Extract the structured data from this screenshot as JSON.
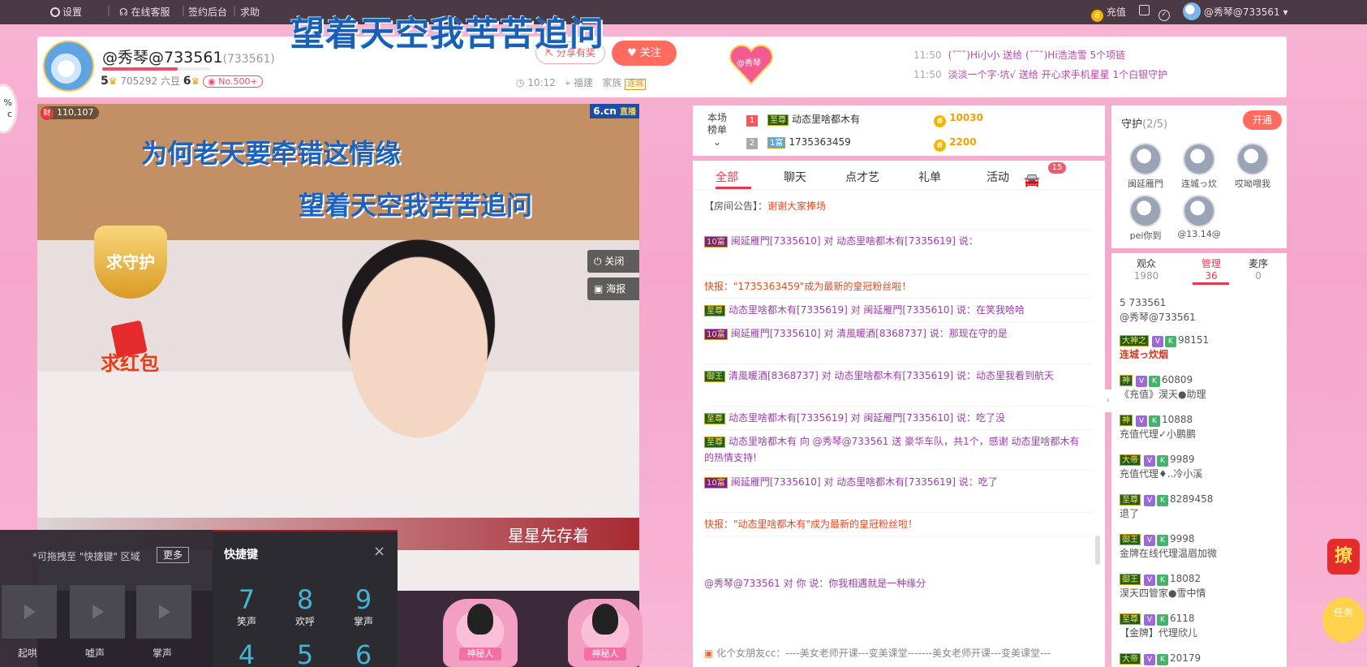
{
  "topbar": {
    "settings": "设置",
    "service": "在线客服",
    "sign_backend": "签约后台",
    "help": "求助",
    "recharge": "充值",
    "user": "@秀琴@733561"
  },
  "song": {
    "title": "望着天空我苦苦追问"
  },
  "anchor": {
    "name": "@秀琴@733561",
    "room_id": "(733561)",
    "wealth_level": "5",
    "beans": "705292 六豆",
    "star_level": "6",
    "rank_badge": "No.500+",
    "share": "分享有奖",
    "follow": "关注",
    "time": "10:12",
    "location": "福建",
    "family_label": "家族",
    "family_tag": "连城",
    "heart_badge": "@秀琴"
  },
  "gift_news": [
    {
      "time": "11:50",
      "text": "(ˇ‾ˇ)Hi小小 送给 (ˇ‾ˇ)Hi浩浩雪 5个项链"
    },
    {
      "time": "11:50",
      "text": "淡淡一个字·坑√ 送给 开心求手机星星 1个白银守护"
    }
  ],
  "video": {
    "watermark": "6.cn",
    "watermark_live": "直播",
    "coin_icon": "财",
    "coins": "110,107",
    "lyric1": "为何老天要牵错这情缘",
    "lyric2": "望着天空我苦苦追问",
    "close": "关闭",
    "poster": "海报",
    "guard": "求守护",
    "redpack": "求红包",
    "next_song": "星星先存着",
    "seat1": "神秘人",
    "seat2": "神秘人"
  },
  "drag_tip": {
    "text": "*可拖拽至 \"快捷键\" 区域",
    "more": "更多",
    "slots": [
      "起哄",
      "嘘声",
      "掌声"
    ]
  },
  "shortcut": {
    "title": "快捷键",
    "close": "×",
    "keys": [
      {
        "num": "7",
        "label": "笑声"
      },
      {
        "num": "8",
        "label": "欢呼"
      },
      {
        "num": "9",
        "label": "掌声"
      },
      {
        "num": "4",
        "label": ""
      },
      {
        "num": "5",
        "label": ""
      },
      {
        "num": "6",
        "label": ""
      }
    ]
  },
  "rank": {
    "title1": "本场",
    "title2": "榜单",
    "rows": [
      {
        "rank": "1",
        "tag": "至尊",
        "name": "动态里啥都木有",
        "score": "10030"
      },
      {
        "rank": "2",
        "tag": "1富",
        "name": "1735363459",
        "score": "2200"
      }
    ]
  },
  "chat": {
    "tabs": [
      "全部",
      "聊天",
      "点才艺",
      "礼单",
      "活动"
    ],
    "car_count": "15",
    "notice_label": "【房间公告】：",
    "notice_text": "谢谢大家捧场",
    "msgs": [
      "闽延雁門[7335610] 对 动态里啥都木有[7335619] 说：",
      "快报：\"1735363459\"成为最新的皇冠粉丝啦！",
      "动态里啥都木有[7335619] 对 闽延雁門[7335610] 说：在笑我哈哈",
      "闽延雁門[7335610] 对 清風暖酒[8368737] 说：那现在守的是",
      "清風暖酒[8368737] 对 动态里啥都木有[7335619] 说：动态里我看到航天",
      "动态里啥都木有[7335619] 对 闽延雁門[7335610] 说：吃了没",
      "动态里啥都木有 向 @秀琴@733561 送 豪华车队，共1个，感谢 动态里啥都木有 的热情支持!",
      "闽延雁門[7335610] 对 动态里啥都木有[7335619] 说：吃了",
      "快报：\"动态里啥都木有\"成为最新的皇冠粉丝啦！"
    ],
    "whisper": "@秀琴@733561 对 你 说：你我相遇就是一种缘分",
    "bottom_ad": "化个女朋友cc：----美女老师开课---变美课堂-------美女老师开课---变美课堂---"
  },
  "guard": {
    "title": "守护",
    "count": "(2/5)",
    "open": "开通",
    "members": [
      "闽延雁門",
      "连城っ炊",
      "哎呦喂我",
      "pei你到",
      "@13.14@"
    ]
  },
  "users": {
    "tabs": [
      {
        "label": "观众",
        "count": "1980"
      },
      {
        "label": "管理",
        "count": "36"
      },
      {
        "label": "麦序",
        "count": "0"
      }
    ],
    "list": [
      {
        "line1": "5 733561",
        "line2": "@秀琴@733561"
      },
      {
        "line1": "98151",
        "line2": "连城っ炊烟"
      },
      {
        "line1": "60809",
        "line2": "《充值》淏天●助理"
      },
      {
        "line1": "10888",
        "line2": "充值代理✓小鹏鹏"
      },
      {
        "line1": "9989",
        "line2": "充值代理♦..冷小溪"
      },
      {
        "line1": "8289458",
        "line2": "退了"
      },
      {
        "line1": "9998",
        "line2": "金牌在线代理温眉加微"
      },
      {
        "line1": "18082",
        "line2": "淏天四管家●雪中情"
      },
      {
        "line1": "6118",
        "line2": "【金牌】代理欣儿"
      },
      {
        "line1": "20179",
        "line2": ""
      }
    ]
  },
  "misc": {
    "pct": "%",
    "pct2": "c",
    "pick": "撩",
    "task": "任务"
  }
}
